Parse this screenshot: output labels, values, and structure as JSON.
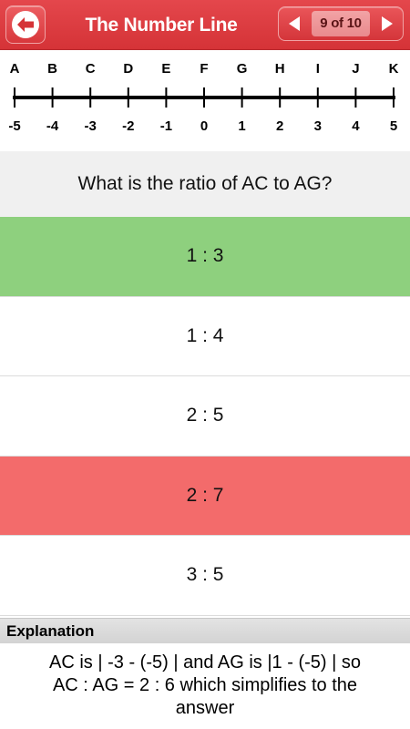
{
  "header": {
    "title": "The Number Line",
    "pager_text": "9 of 10",
    "back_icon": "back-arrow-icon",
    "prev_icon": "triangle-left-icon",
    "next_icon": "triangle-right-icon",
    "accent_color": "#d93a3e"
  },
  "number_line": {
    "letters": [
      "A",
      "B",
      "C",
      "D",
      "E",
      "F",
      "G",
      "H",
      "I",
      "J",
      "K"
    ],
    "values": [
      "-5",
      "-4",
      "-3",
      "-2",
      "-1",
      "0",
      "1",
      "2",
      "3",
      "4",
      "5"
    ]
  },
  "question": {
    "text": "What is the ratio of AC to AG?"
  },
  "answers": [
    {
      "label": "1 : 3",
      "state": "correct"
    },
    {
      "label": "1 : 4",
      "state": "none"
    },
    {
      "label": "2 : 5",
      "state": "none"
    },
    {
      "label": "2 : 7",
      "state": "wrong"
    },
    {
      "label": "3 : 5",
      "state": "none"
    }
  ],
  "explanation": {
    "heading": "Explanation",
    "line1": "AC is | -3 - (-5) | and AG is |1 - (-5) | so",
    "line2": "AC : AG = 2 : 6 which simplifies to the",
    "line3": "answer"
  },
  "colors": {
    "correct": "#8ed07e",
    "wrong": "#f36b6b"
  }
}
